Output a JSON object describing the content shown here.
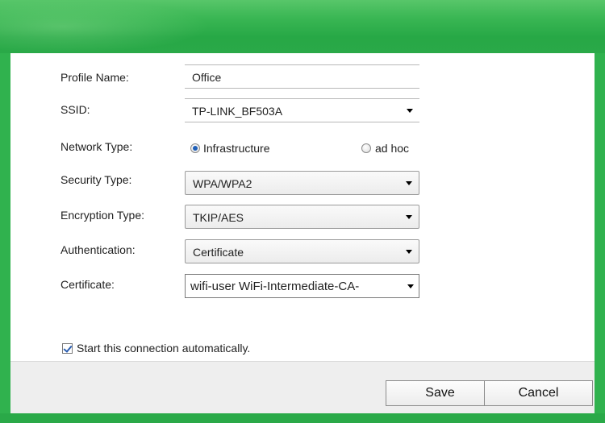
{
  "form": {
    "profile_name": {
      "label": "Profile Name:",
      "value": "Office"
    },
    "ssid": {
      "label": "SSID:",
      "value": "TP-LINK_BF503A"
    },
    "network_type": {
      "label": "Network Type:",
      "options": [
        "Infrastructure",
        "ad hoc"
      ],
      "selected": "Infrastructure"
    },
    "security_type": {
      "label": "Security Type:",
      "value": "WPA/WPA2"
    },
    "encryption_type": {
      "label": "Encryption Type:",
      "value": "TKIP/AES"
    },
    "authentication": {
      "label": "Authentication:",
      "value": "Certificate"
    },
    "certificate": {
      "label": "Certificate:",
      "value": "wifi-user WiFi-Intermediate-CA-"
    },
    "auto_start": {
      "label": "Start this connection automatically.",
      "checked": true
    }
  },
  "buttons": {
    "save": "Save",
    "cancel": "Cancel"
  },
  "colors": {
    "frame_green": "#2bb04a",
    "radio_selected": "#1f5fb8"
  },
  "icons": [
    "chevron-down-icon",
    "radio-selected-icon",
    "radio-unselected-icon",
    "checkbox-checked-icon"
  ]
}
